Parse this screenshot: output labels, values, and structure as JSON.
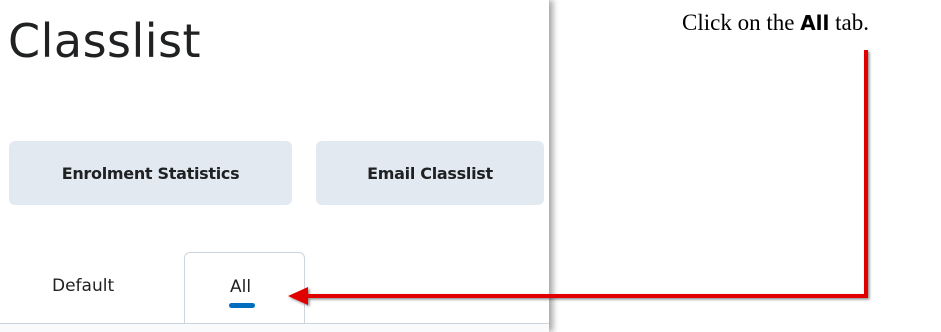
{
  "page": {
    "title": "Classlist"
  },
  "buttons": {
    "enrolment_statistics": "Enrolment Statistics",
    "email_classlist": "Email Classlist"
  },
  "tabs": [
    {
      "label": "Default",
      "selected": false
    },
    {
      "label": "All",
      "selected": true
    }
  ],
  "instruction": {
    "prefix": "Click on the ",
    "bold": "All",
    "suffix": " tab."
  },
  "colors": {
    "button_bg": "#e3e9f1",
    "tab_indicator": "#006fbf",
    "callout_arrow": "#e00000"
  },
  "icons": {
    "callout": "arrow-pointing-left"
  }
}
